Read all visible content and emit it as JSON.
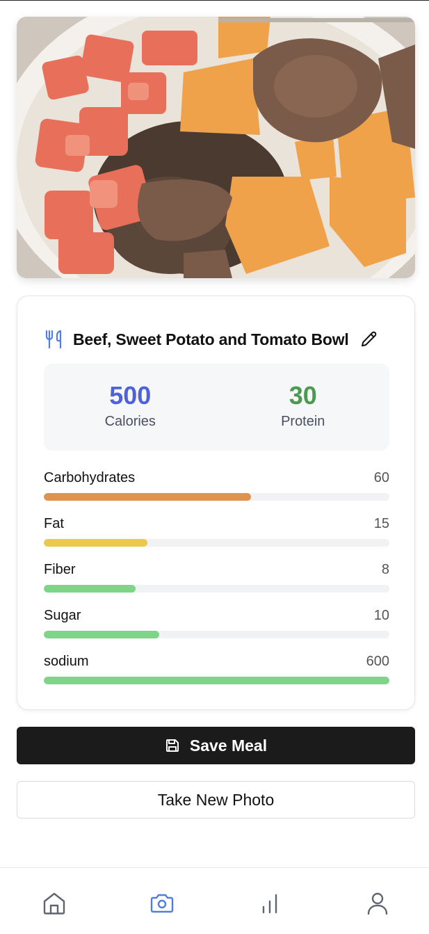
{
  "meal": {
    "photo_alt": "Beef, Sweet Potato and Tomato Bowl photo",
    "name": "Beef, Sweet Potato and Tomato Bowl"
  },
  "stats": {
    "calories_value": "500",
    "calories_label": "Calories",
    "protein_value": "30",
    "protein_label": "Protein",
    "calories_color": "#4f63d6",
    "protein_color": "#4a9a4f"
  },
  "nutrients": [
    {
      "name": "Carbohydrates",
      "amount": "60",
      "fraction": 0.6,
      "color": "#e0924f"
    },
    {
      "name": "Fat",
      "amount": "15",
      "fraction": 0.3,
      "color": "#ecc94b"
    },
    {
      "name": "Fiber",
      "amount": "8",
      "fraction": 0.265,
      "color": "#7ed58a"
    },
    {
      "name": "Sugar",
      "amount": "10",
      "fraction": 0.333,
      "color": "#7ed58a"
    },
    {
      "name": "sodium",
      "amount": "600",
      "fraction": 1.0,
      "color": "#7ed58a"
    }
  ],
  "actions": {
    "save_label": "Save Meal",
    "new_photo_label": "Take New Photo"
  },
  "icons": {
    "title": "utensils-icon",
    "edit": "pencil-icon",
    "save": "floppy-disk-icon",
    "nav": [
      "home-icon",
      "camera-icon",
      "bar-chart-icon",
      "user-icon"
    ]
  },
  "nav": {
    "active_color": "#4f7de0",
    "inactive_color": "#5f6470"
  }
}
